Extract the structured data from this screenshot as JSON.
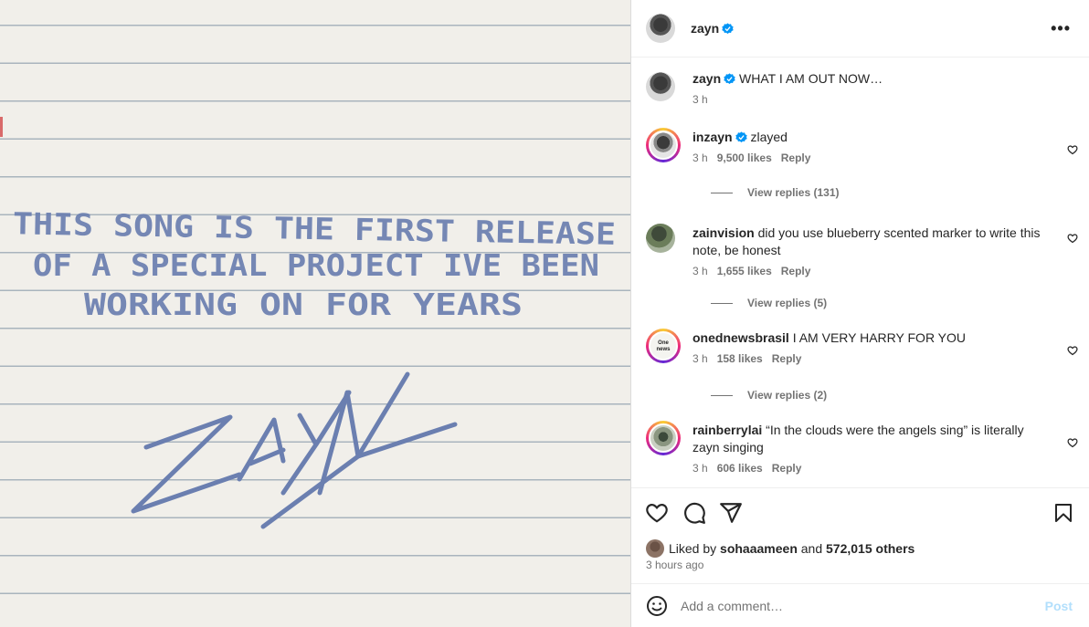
{
  "post": {
    "author": "zayn",
    "image": {
      "note_lines": [
        "THIS SONG IS THE FIRST RELEASE",
        "OF A SPECIAL PROJECT IVE BEEN",
        "WORKING ON FOR YEARS"
      ],
      "signature": "ZAYN",
      "ink_color": "#6b7fb0"
    }
  },
  "caption": {
    "author": "zayn",
    "text": "WHAT I AM OUT NOW…",
    "time": "3 h"
  },
  "comments": [
    {
      "author": "inzayn",
      "verified": true,
      "text": "zlayed",
      "time": "3 h",
      "likes": "9,500 likes",
      "reply": "Reply",
      "view_replies": "View replies (131)"
    },
    {
      "author": "zainvision",
      "verified": false,
      "text": "did you use blueberry scented marker to write this note, be honest",
      "time": "3 h",
      "likes": "1,655 likes",
      "reply": "Reply",
      "view_replies": "View replies (5)"
    },
    {
      "author": "onednewsbrasil",
      "verified": false,
      "text": "I AM VERY HARRY FOR YOU",
      "time": "3 h",
      "likes": "158 likes",
      "reply": "Reply",
      "view_replies": "View replies (2)",
      "avatar_text": [
        "One",
        "news"
      ]
    },
    {
      "author": "rainberrylai",
      "verified": false,
      "text": "“In the clouds were the angels sing” is literally zayn singing",
      "time": "3 h",
      "likes": "606 likes",
      "reply": "Reply"
    }
  ],
  "likes": {
    "liked_by": "Liked by",
    "user": "sohaaameen",
    "and": "and",
    "others": "572,015 others"
  },
  "time_ago": "3 hours ago",
  "add_comment": {
    "placeholder": "Add a comment…",
    "post_label": "Post"
  },
  "colors": {
    "verified": "#0095f6",
    "post_disabled": "#b2dffc"
  }
}
